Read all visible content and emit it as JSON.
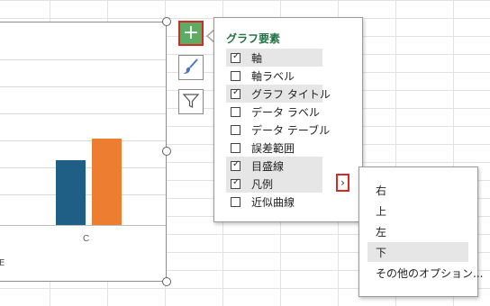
{
  "chart": {
    "category_label": "C",
    "legend_fragment": "E",
    "colors": {
      "series1": "#1f5f85",
      "series2": "#ed7d31"
    }
  },
  "side_buttons": {
    "add_element_icon": "plus-icon",
    "styles_icon": "paintbrush-icon",
    "filters_icon": "funnel-icon"
  },
  "chart_elements_panel": {
    "title": "グラフ要素",
    "options": [
      {
        "label": "軸",
        "checked": true,
        "highlighted": true
      },
      {
        "label": "軸ラベル",
        "checked": false,
        "highlighted": false
      },
      {
        "label": "グラフ タイトル",
        "checked": true,
        "highlighted": true
      },
      {
        "label": "データ ラベル",
        "checked": false,
        "highlighted": false
      },
      {
        "label": "データ テーブル",
        "checked": false,
        "highlighted": false
      },
      {
        "label": "誤差範囲",
        "checked": false,
        "highlighted": false
      },
      {
        "label": "目盛線",
        "checked": true,
        "highlighted": true
      },
      {
        "label": "凡例",
        "checked": true,
        "highlighted": true
      },
      {
        "label": "近似曲線",
        "checked": false,
        "highlighted": false
      }
    ],
    "expand_arrow": "›"
  },
  "legend_submenu": {
    "items": [
      {
        "label": "右",
        "highlighted": false
      },
      {
        "label": "上",
        "highlighted": false
      },
      {
        "label": "左",
        "highlighted": false
      },
      {
        "label": "下",
        "highlighted": true
      },
      {
        "label": "その他のオプション...",
        "highlighted": false
      }
    ]
  }
}
